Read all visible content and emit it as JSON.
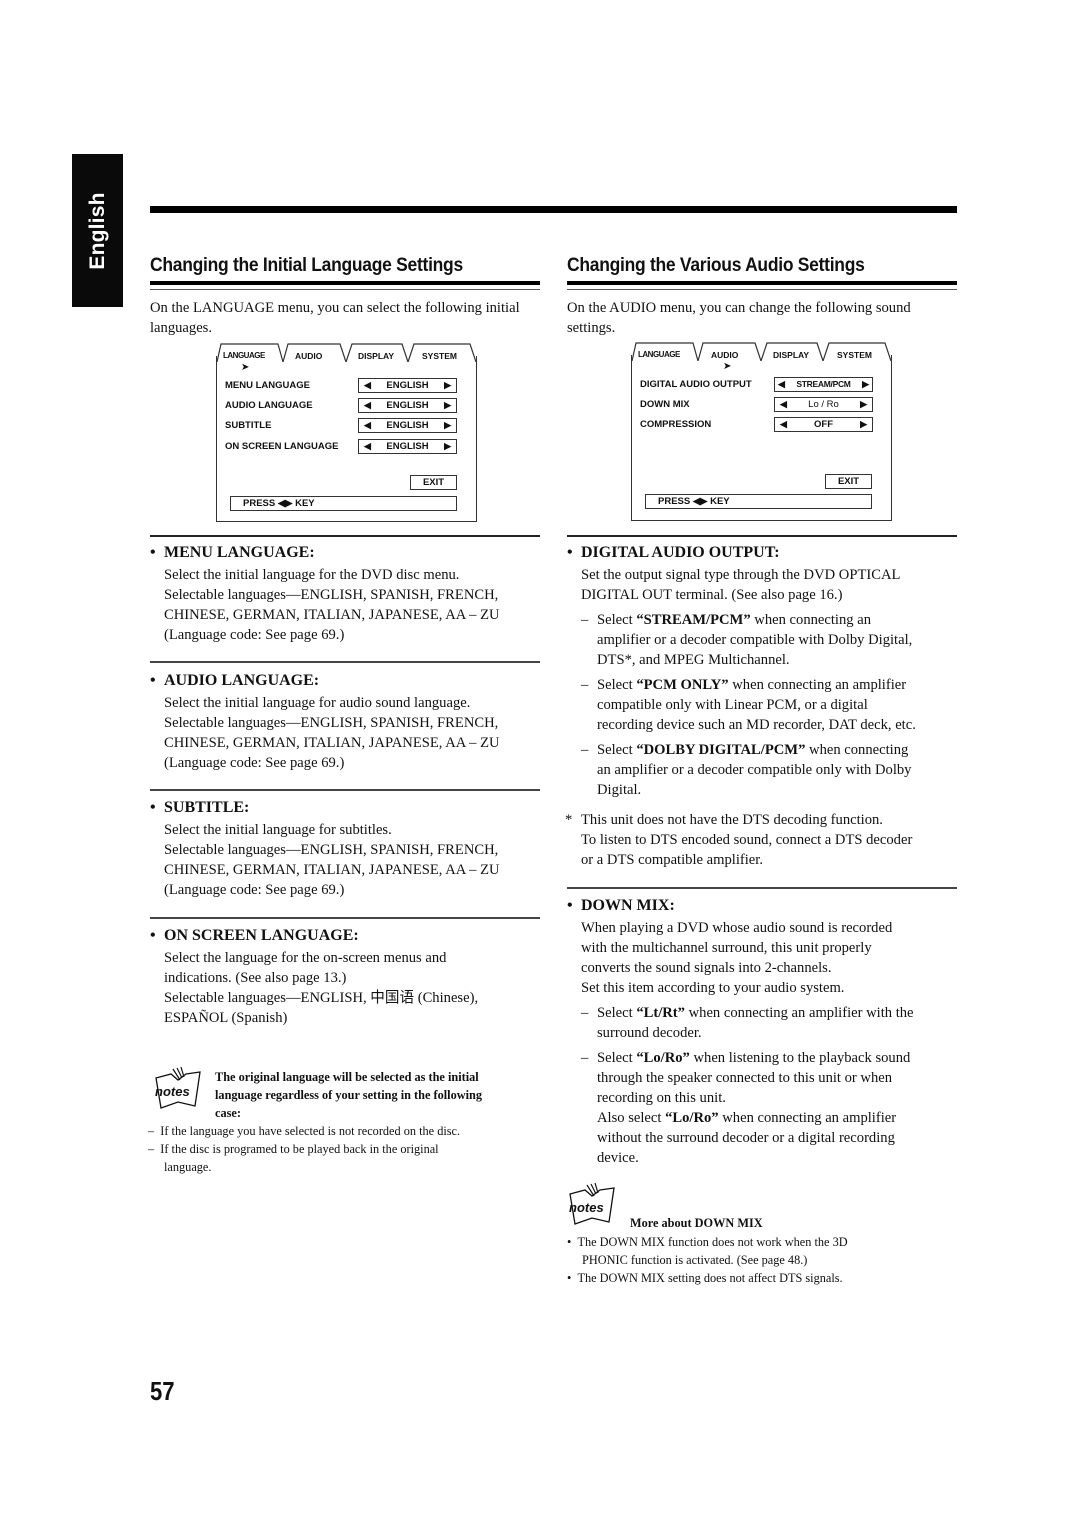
{
  "side_tab": {
    "label": "English"
  },
  "page_number": "57",
  "left": {
    "title": "Changing the Initial Language Settings",
    "intro": "On the LANGUAGE menu, you can select the following initial languages.",
    "osd": {
      "tabs": [
        "LANGUAGE",
        "AUDIO",
        "DISPLAY",
        "SYSTEM"
      ],
      "active_tab": "LANGUAGE",
      "rows": [
        {
          "label": "MENU LANGUAGE",
          "value": "ENGLISH"
        },
        {
          "label": "AUDIO LANGUAGE",
          "value": "ENGLISH"
        },
        {
          "label": "SUBTITLE",
          "value": "ENGLISH"
        },
        {
          "label": "ON SCREEN LANGUAGE",
          "value": "ENGLISH"
        }
      ],
      "arrow_left": "◀",
      "arrow_right": "▶",
      "exit": "EXIT",
      "press_key": "PRESS ◀▶ KEY"
    },
    "items": [
      {
        "heading": "MENU LANGUAGE:",
        "lines": [
          "Select the initial language for the DVD disc menu.",
          "Selectable languages—ENGLISH, SPANISH, FRENCH,",
          "CHINESE, GERMAN, ITALIAN, JAPANESE, AA – ZU",
          "(Language code: See page 69.)"
        ]
      },
      {
        "heading": "AUDIO LANGUAGE:",
        "lines": [
          "Select the initial language for audio sound language.",
          "Selectable languages—ENGLISH, SPANISH, FRENCH,",
          "CHINESE, GERMAN, ITALIAN, JAPANESE, AA – ZU",
          "(Language code: See page 69.)"
        ]
      },
      {
        "heading": "SUBTITLE:",
        "lines": [
          "Select the initial language for subtitles.",
          "Selectable languages—ENGLISH, SPANISH, FRENCH,",
          "CHINESE, GERMAN, ITALIAN, JAPANESE, AA – ZU",
          "(Language code: See page 69.)"
        ]
      },
      {
        "heading": "ON SCREEN LANGUAGE:",
        "lines": [
          "Select the language for the on-screen menus and",
          "indications. (See also page 13.)",
          "Selectable languages—ENGLISH, 中国语 (Chinese),",
          "ESPAÑOL (Spanish)"
        ]
      }
    ],
    "notes": {
      "icon_label": "notes",
      "heading_lines": [
        "The original language will be selected as the initial",
        "language regardless of your setting in the following",
        "case:"
      ],
      "bullets": [
        "If the language you have selected is not recorded on the disc.",
        "If the disc is programed to be played back in the original",
        "language."
      ]
    }
  },
  "right": {
    "title": "Changing the Various Audio Settings",
    "intro": "On the AUDIO menu, you can change the following sound settings.",
    "osd": {
      "tabs": [
        "LANGUAGE",
        "AUDIO",
        "DISPLAY",
        "SYSTEM"
      ],
      "active_tab": "AUDIO",
      "rows": [
        {
          "label": "DIGITAL AUDIO OUTPUT",
          "value": "STREAM/PCM"
        },
        {
          "label": "DOWN MIX",
          "value": "Lo / Ro"
        },
        {
          "label": "COMPRESSION",
          "value": "OFF"
        }
      ],
      "arrow_left": "◀",
      "arrow_right": "▶",
      "exit": "EXIT",
      "press_key": "PRESS ◀▶ KEY"
    },
    "digital_audio_output": {
      "heading": "DIGITAL AUDIO OUTPUT:",
      "lines": [
        "Set the output signal type through the DVD OPTICAL",
        "DIGITAL OUT terminal. (See also page 16.)"
      ],
      "options": [
        {
          "pre": "Select ",
          "bold": "“STREAM/PCM”",
          "post": " when connecting an",
          "more": [
            "amplifier or a decoder compatible with Dolby Digital,",
            "DTS*, and MPEG Multichannel."
          ]
        },
        {
          "pre": "Select ",
          "bold": "“PCM ONLY”",
          "post": " when connecting an amplifier",
          "more": [
            "compatible only with Linear PCM, or a digital",
            "recording device such an MD recorder, DAT deck, etc."
          ]
        },
        {
          "pre": "Select ",
          "bold": "“DOLBY DIGITAL/PCM”",
          "post": " when connecting",
          "more": [
            "an amplifier or a decoder compatible only with Dolby",
            "Digital."
          ]
        }
      ],
      "footnote_mark": "*",
      "footnote": [
        "This unit does not have the DTS decoding function.",
        "To listen to DTS encoded sound, connect a DTS decoder",
        "or a DTS compatible amplifier."
      ]
    },
    "down_mix": {
      "heading": "DOWN MIX:",
      "lines": [
        "When playing a DVD whose audio sound is recorded",
        "with the multichannel surround, this unit properly",
        "converts the sound signals into 2-channels.",
        "Set this item according to your audio system."
      ],
      "options": [
        {
          "pre": "Select ",
          "bold": "“Lt/Rt”",
          "post": " when connecting an amplifier with the",
          "more": [
            "surround decoder."
          ]
        },
        {
          "pre": "Select ",
          "bold": "“Lo/Ro”",
          "post": " when listening to the playback sound",
          "more": [
            "through the speaker connected to this unit or when",
            "recording on this unit."
          ]
        }
      ],
      "also": {
        "pre": "Also select ",
        "bold": "“Lo/Ro”",
        "post": " when connecting an amplifier",
        "more": [
          "without the surround decoder or a digital recording",
          "device."
        ]
      }
    },
    "notes": {
      "icon_label": "notes",
      "heading": "More about DOWN MIX",
      "bullets": [
        "The DOWN MIX function does not work when the 3D",
        "PHONIC function is activated. (See page 48.)",
        "The DOWN MIX setting does not affect DTS signals."
      ]
    }
  }
}
